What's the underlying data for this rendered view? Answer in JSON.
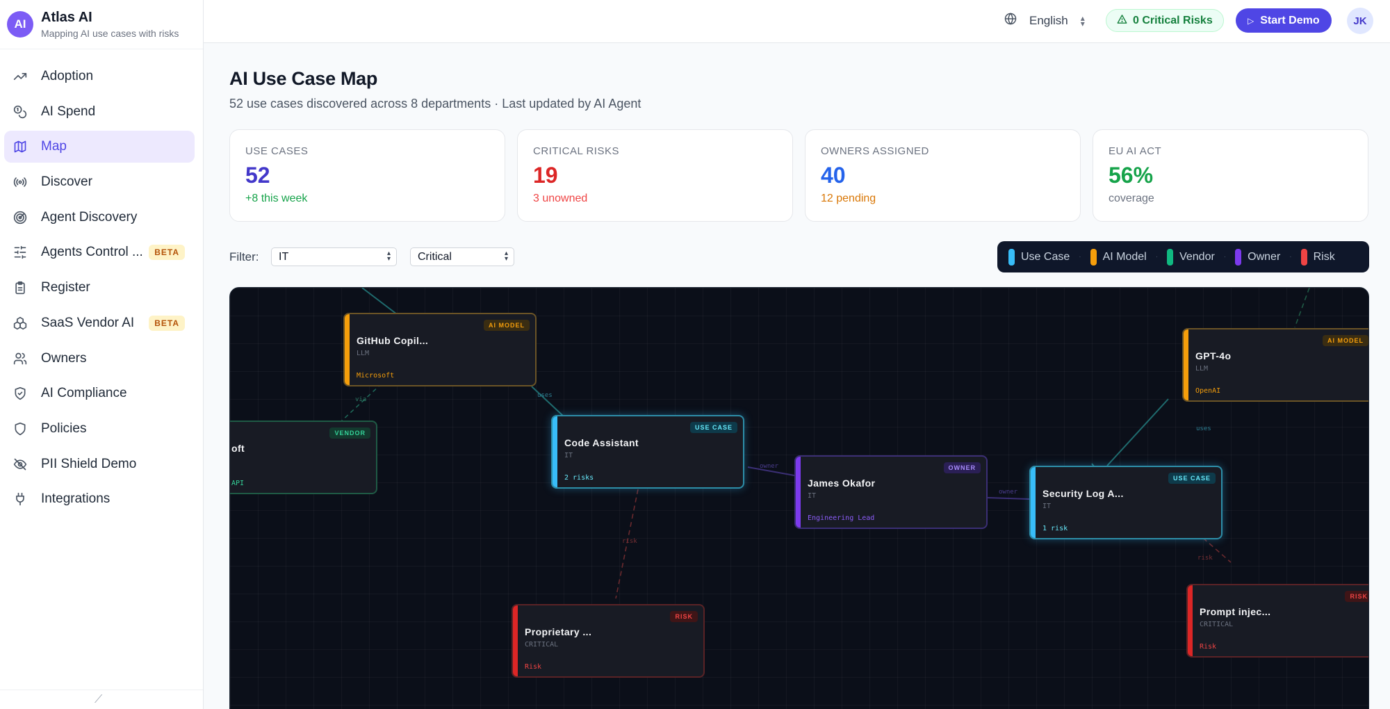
{
  "brand": {
    "logo": "AI",
    "title": "Atlas AI",
    "subtitle": "Mapping AI use cases with risks"
  },
  "nav": [
    {
      "label": "Adoption",
      "icon": "trending-up-icon"
    },
    {
      "label": "AI Spend",
      "icon": "coins-icon"
    },
    {
      "label": "Map",
      "icon": "map-icon",
      "active": true
    },
    {
      "label": "Discover",
      "icon": "radio-icon"
    },
    {
      "label": "Agent Discovery",
      "icon": "radar-icon"
    },
    {
      "label": "Agents Control ...",
      "icon": "sliders-icon",
      "badge": "BETA"
    },
    {
      "label": "Register",
      "icon": "clipboard-icon"
    },
    {
      "label": "SaaS Vendor AI",
      "icon": "boxes-icon",
      "badge": "BETA"
    },
    {
      "label": "Owners",
      "icon": "users-icon"
    },
    {
      "label": "AI Compliance",
      "icon": "shield-check-icon"
    },
    {
      "label": "Policies",
      "icon": "shield-icon"
    },
    {
      "label": "PII Shield Demo",
      "icon": "eye-off-icon"
    },
    {
      "label": "Integrations",
      "icon": "plug-icon"
    }
  ],
  "topbar": {
    "language": "English",
    "critical_risks": "0 Critical Risks",
    "start_demo": "Start Demo",
    "avatar": "JK"
  },
  "header": {
    "title": "AI Use Case Map",
    "subtitle": "52 use cases discovered across 8 departments · Last updated by AI Agent"
  },
  "stats": [
    {
      "label": "USE CASES",
      "value": "52",
      "sub": "+8 this week",
      "value_color": "#4338ca",
      "sub_color": "#16a34a"
    },
    {
      "label": "CRITICAL RISKS",
      "value": "19",
      "sub": "3 unowned",
      "value_color": "#dc2626",
      "sub_color": "#ef4444"
    },
    {
      "label": "OWNERS ASSIGNED",
      "value": "40",
      "sub": "12 pending",
      "value_color": "#2563eb",
      "sub_color": "#d97706"
    },
    {
      "label": "EU AI ACT",
      "value": "56%",
      "sub": "coverage",
      "value_color": "#16a34a",
      "sub_color": "#6b7280"
    }
  ],
  "filters": {
    "label": "Filter:",
    "department": "IT",
    "severity": "Critical"
  },
  "legend": [
    {
      "label": "Use Case",
      "color": "#38bdf8"
    },
    {
      "label": "AI Model",
      "color": "#f59e0b"
    },
    {
      "label": "Vendor",
      "color": "#10b981"
    },
    {
      "label": "Owner",
      "color": "#7c3aed"
    },
    {
      "label": "Risk",
      "color": "#ef4444"
    }
  ],
  "nodes": {
    "github_copilot": {
      "tag": "AI MODEL",
      "name": "GitHub Copil...",
      "type": "LLM",
      "footer": "Microsoft"
    },
    "gpt4o": {
      "tag": "AI MODEL",
      "name": "GPT-4o",
      "type": "LLM",
      "footer": "OpenAI"
    },
    "vendor_microsoft": {
      "tag": "VENDOR",
      "name": "oft",
      "type": "",
      "footer": "API"
    },
    "code_assistant": {
      "tag": "USE CASE",
      "name": "Code Assistant",
      "type": "IT",
      "footer": "2 risks"
    },
    "james_okafor": {
      "tag": "OWNER",
      "name": "James Okafor",
      "type": "IT",
      "footer": "Engineering Lead"
    },
    "security_log": {
      "tag": "USE CASE",
      "name": "Security Log A...",
      "type": "IT",
      "footer": "1 risk"
    },
    "proprietary": {
      "tag": "RISK",
      "name": "Proprietary ...",
      "type": "CRITICAL",
      "footer": "Risk"
    },
    "prompt_injection": {
      "tag": "RISK",
      "name": "Prompt injec...",
      "type": "CRITICAL",
      "footer": "Risk"
    }
  },
  "edge_labels": {
    "via": "via",
    "uses_1": "uses",
    "uses_2": "uses",
    "owner_1": "owner",
    "owner_2": "owner",
    "risk_1": "risk",
    "risk_2": "risk"
  }
}
